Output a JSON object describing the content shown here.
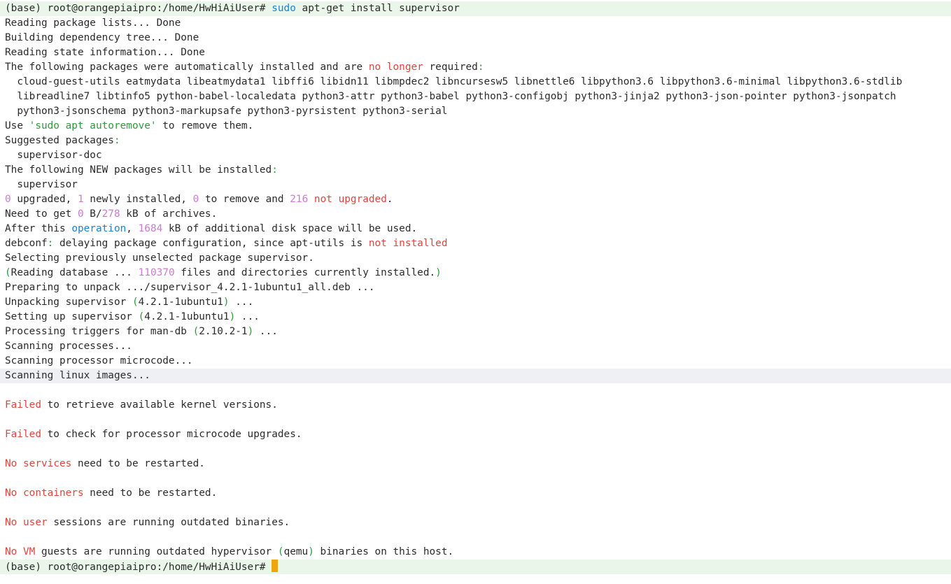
{
  "colors": {
    "default": "#2b2b2b",
    "red": "#e0443e",
    "green": "#2e9a3e",
    "blue": "#1a83d8",
    "magenta": "#cc7ad0",
    "cursor": "#f0a30a",
    "highlight_green": "#eaf6ea",
    "highlight_gray": "#eef0f4"
  },
  "terminal": {
    "lines": [
      {
        "hl": "green",
        "segs": [
          {
            "t": "(base) root@orangepiaipro:/home/HwHiAiUser# "
          },
          {
            "t": "sudo",
            "c": "blue"
          },
          {
            "t": " "
          },
          {
            "t": "apt-get install supervisor",
            "c": "default"
          }
        ]
      },
      {
        "segs": [
          {
            "t": "Reading package lists... Done"
          }
        ]
      },
      {
        "segs": [
          {
            "t": "Building dependency tree... Done"
          }
        ]
      },
      {
        "segs": [
          {
            "t": "Reading state information... Done"
          }
        ]
      },
      {
        "segs": [
          {
            "t": "The following packages were automatically installed and are "
          },
          {
            "t": "no longer",
            "c": "red"
          },
          {
            "t": " required"
          },
          {
            "t": ":",
            "c": "green"
          }
        ]
      },
      {
        "segs": [
          {
            "t": "  cloud-guest-utils eatmydata libeatmydata1 libffi6 libidn11 libmpdec2 libncursesw5 libnettle6 libpython3.6 libpython3.6-minimal libpython3.6-stdlib"
          }
        ]
      },
      {
        "segs": [
          {
            "t": "  libreadline7 libtinfo5 python-babel-localedata python3-attr python3-babel python3-configobj python3-jinja2 python3-json-pointer python3-jsonpatch"
          }
        ]
      },
      {
        "segs": [
          {
            "t": "  python3-jsonschema python3-markupsafe python3-pyrsistent python3-serial"
          }
        ]
      },
      {
        "segs": [
          {
            "t": "Use "
          },
          {
            "t": "'sudo apt autoremove'",
            "c": "green"
          },
          {
            "t": " to remove them."
          }
        ]
      },
      {
        "segs": [
          {
            "t": "Suggested packages"
          },
          {
            "t": ":",
            "c": "green"
          }
        ]
      },
      {
        "segs": [
          {
            "t": "  supervisor-doc"
          }
        ]
      },
      {
        "segs": [
          {
            "t": "The following NEW packages will be installed"
          },
          {
            "t": ":",
            "c": "green"
          }
        ]
      },
      {
        "segs": [
          {
            "t": "  supervisor"
          }
        ]
      },
      {
        "segs": [
          {
            "t": "0",
            "c": "magenta"
          },
          {
            "t": " upgraded, "
          },
          {
            "t": "1",
            "c": "magenta"
          },
          {
            "t": " newly installed, "
          },
          {
            "t": "0",
            "c": "magenta"
          },
          {
            "t": " to remove and "
          },
          {
            "t": "216",
            "c": "magenta"
          },
          {
            "t": " "
          },
          {
            "t": "not upgraded",
            "c": "red"
          },
          {
            "t": "."
          }
        ]
      },
      {
        "segs": [
          {
            "t": "Need to get "
          },
          {
            "t": "0",
            "c": "magenta"
          },
          {
            "t": " B/"
          },
          {
            "t": "278",
            "c": "magenta"
          },
          {
            "t": " kB of archives."
          }
        ]
      },
      {
        "segs": [
          {
            "t": "After this "
          },
          {
            "t": "operation",
            "c": "blue"
          },
          {
            "t": ", "
          },
          {
            "t": "1684",
            "c": "magenta"
          },
          {
            "t": " kB of additional disk space will be used."
          }
        ]
      },
      {
        "segs": [
          {
            "t": "debconf"
          },
          {
            "t": ":",
            "c": "green"
          },
          {
            "t": " delaying package configuration, since apt-utils is "
          },
          {
            "t": "not installed",
            "c": "red"
          }
        ]
      },
      {
        "segs": [
          {
            "t": "Selecting previously unselected package supervisor."
          }
        ]
      },
      {
        "segs": [
          {
            "t": "(",
            "c": "green"
          },
          {
            "t": "Reading database ... "
          },
          {
            "t": "110370",
            "c": "magenta"
          },
          {
            "t": " files and directories currently installed."
          },
          {
            "t": ")",
            "c": "green"
          }
        ]
      },
      {
        "segs": [
          {
            "t": "Preparing to unpack .../supervisor_4.2.1-1ubuntu1_all.deb ..."
          }
        ]
      },
      {
        "segs": [
          {
            "t": "Unpacking supervisor "
          },
          {
            "t": "(",
            "c": "green"
          },
          {
            "t": "4.2.1-1ubuntu1"
          },
          {
            "t": ")",
            "c": "green"
          },
          {
            "t": " ..."
          }
        ]
      },
      {
        "segs": [
          {
            "t": "Setting up supervisor "
          },
          {
            "t": "(",
            "c": "green"
          },
          {
            "t": "4.2.1-1ubuntu1"
          },
          {
            "t": ")",
            "c": "green"
          },
          {
            "t": " ..."
          }
        ]
      },
      {
        "segs": [
          {
            "t": "Processing triggers for man-db "
          },
          {
            "t": "(",
            "c": "green"
          },
          {
            "t": "2.10.2-1"
          },
          {
            "t": ")",
            "c": "green"
          },
          {
            "t": " ..."
          }
        ]
      },
      {
        "segs": [
          {
            "t": "Scanning processes..."
          }
        ]
      },
      {
        "segs": [
          {
            "t": "Scanning processor microcode..."
          }
        ]
      },
      {
        "hl": "gray",
        "segs": [
          {
            "t": "Scanning linux images..."
          }
        ]
      },
      {
        "segs": []
      },
      {
        "segs": [
          {
            "t": "Failed",
            "c": "red"
          },
          {
            "t": " to retrieve available kernel versions."
          }
        ]
      },
      {
        "segs": []
      },
      {
        "segs": [
          {
            "t": "Failed",
            "c": "red"
          },
          {
            "t": " to check for processor microcode upgrades."
          }
        ]
      },
      {
        "segs": []
      },
      {
        "segs": [
          {
            "t": "No",
            "c": "red"
          },
          {
            "t": " "
          },
          {
            "t": "services",
            "c": "red"
          },
          {
            "t": " need to be restarted."
          }
        ]
      },
      {
        "segs": []
      },
      {
        "segs": [
          {
            "t": "No",
            "c": "red"
          },
          {
            "t": " "
          },
          {
            "t": "containers",
            "c": "red"
          },
          {
            "t": " need to be restarted."
          }
        ]
      },
      {
        "segs": []
      },
      {
        "segs": [
          {
            "t": "No",
            "c": "red"
          },
          {
            "t": " "
          },
          {
            "t": "user",
            "c": "red"
          },
          {
            "t": " sessions are running outdated binaries."
          }
        ]
      },
      {
        "segs": []
      },
      {
        "segs": [
          {
            "t": "No",
            "c": "red"
          },
          {
            "t": " "
          },
          {
            "t": "VM",
            "c": "red"
          },
          {
            "t": " guests are running outdated hypervisor "
          },
          {
            "t": "(",
            "c": "green"
          },
          {
            "t": "qemu"
          },
          {
            "t": ")",
            "c": "green"
          },
          {
            "t": " binaries on this host."
          }
        ]
      },
      {
        "hl": "green",
        "cursor": true,
        "segs": [
          {
            "t": "(base) root@orangepiaipro:/home/HwHiAiUser# "
          }
        ]
      }
    ]
  }
}
